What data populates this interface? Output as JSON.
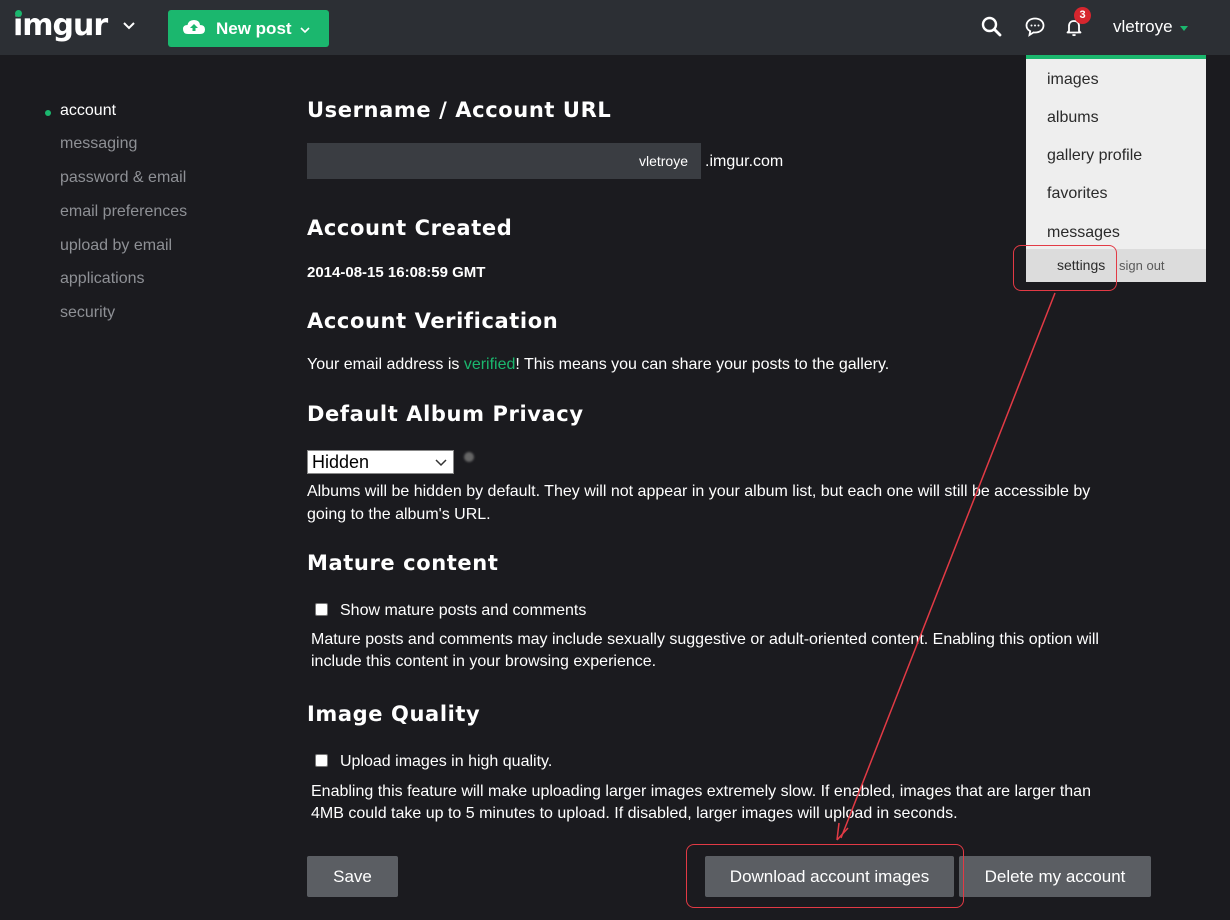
{
  "topbar": {
    "logo": "imgur",
    "new_post_label": "New post",
    "notification_count": "3",
    "username": "vletroye"
  },
  "dropdown": {
    "items": [
      "images",
      "albums",
      "gallery profile",
      "favorites",
      "messages"
    ],
    "settings": "settings",
    "sign_out": "sign out"
  },
  "sidenav": {
    "items": [
      "account",
      "messaging",
      "password & email",
      "email preferences",
      "upload by email",
      "applications",
      "security"
    ],
    "active": "account"
  },
  "main": {
    "username_heading": "Username / Account URL",
    "username_value": "vletroye",
    "url_suffix": ".imgur.com",
    "created_heading": "Account Created",
    "created_value": "2014-08-15 16:08:59 GMT",
    "verification_heading": "Account Verification",
    "verification_pre": "Your email address is ",
    "verification_word": "verified",
    "verification_post": "! This means you can share your posts to the gallery.",
    "privacy_heading": "Default Album Privacy",
    "privacy_selected": "Hidden",
    "privacy_desc_1": "Albums will be hidden by default. They will not appear in your album list, but each one will still be accessible by",
    "privacy_desc_2": "going to the album's URL.",
    "mature_heading": "Mature content",
    "mature_checkbox_label": "Show mature posts and comments",
    "mature_desc_1": "Mature posts and comments may include sexually suggestive or adult-oriented content. Enabling this option will",
    "mature_desc_2": "include this content in your browsing experience.",
    "quality_heading": "Image Quality",
    "quality_checkbox_label": "Upload images in high quality.",
    "quality_desc_1": "Enabling this feature will make uploading larger images extremely slow. If enabled, images that are larger than",
    "quality_desc_2": "4MB could take up to 5 minutes to upload. If disabled, larger images will upload in seconds."
  },
  "buttons": {
    "save": "Save",
    "download": "Download account images",
    "delete": "Delete my account"
  },
  "colors": {
    "accent": "#1bb76e",
    "background": "#1b1b1f",
    "topbar": "#2c2f34",
    "annotation": "#e23a45",
    "badge": "#d6262e"
  },
  "icons": [
    "chevron-down-icon",
    "cloud-upload-icon",
    "search-icon",
    "chat-icon",
    "bell-icon"
  ]
}
